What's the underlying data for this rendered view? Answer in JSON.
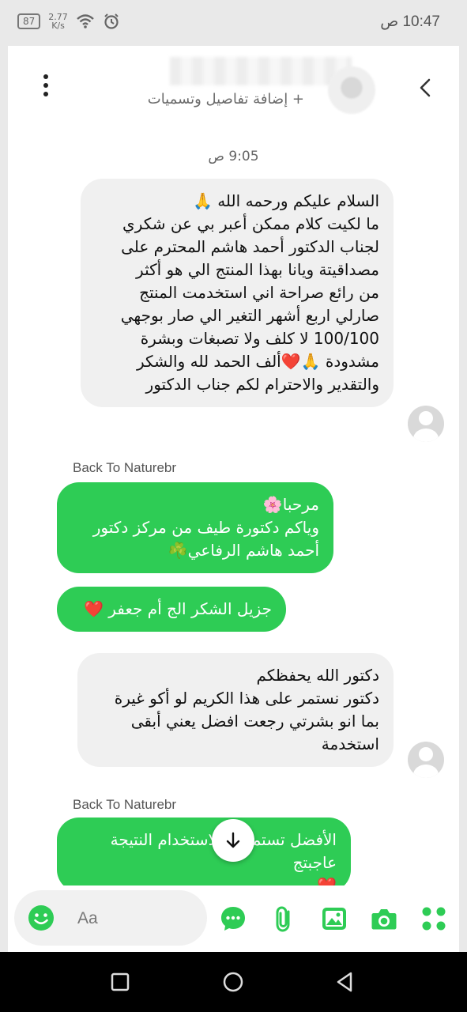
{
  "status_bar": {
    "battery": "87",
    "network_top": "2.77",
    "network_bottom": "K/s",
    "time": "10:47 ص"
  },
  "header": {
    "subtitle": "+ إضافة تفاصيل وتسميات"
  },
  "chat": {
    "timestamp": "9:05 ص",
    "messages": [
      {
        "direction": "incoming",
        "text": "السلام عليكم ورحمه الله 🙏\nما لكيت كلام ممكن أعبر بي عن  شكري\nلجناب الدكتور  أحمد هاشم المحترم على\nمصداقيتة ويانا بهذا المنتج الي هو أكثر\nمن رائع صراحة اني استخدمت المنتج\nصارلي اربع أشهر التغير الي صار بوجهي\n100/100  لا كلف ولا تصبغات وبشرة\nمشدودة 🙏❤️ألف الحمد لله والشكر\nوالتقدير والاحترام لكم جناب الدكتور"
      },
      {
        "direction": "outgoing",
        "sender": "Back To Naturebr",
        "text": "مرحبا🌸\nوياكم دكتورة طيف من مركز دكتور\nأحمد هاشم الرفاعي☘️"
      },
      {
        "direction": "outgoing",
        "text": "جزيل الشكر الج أم جعفر ❤️"
      },
      {
        "direction": "incoming",
        "text": "دكتور الله يحفظكم\nدكتور نستمر على هذا الكريم لو أكو غيرة\nبما انو بشرتي رجعت افضل يعني أبقى\nاستخدمة"
      },
      {
        "direction": "outgoing",
        "sender": "Back To Naturebr",
        "text": "الأفضل تستمري بالاستخدام النتيجة عاجبتج\n❤️"
      }
    ]
  },
  "composer": {
    "placeholder": "Aa"
  },
  "colors": {
    "accent": "#2ecc55",
    "incoming_bubble": "#f0f0f0"
  },
  "icons": [
    "emoji-icon",
    "chat-bubble-icon",
    "attachment-icon",
    "image-icon",
    "camera-icon",
    "apps-grid-icon",
    "scroll-down-icon",
    "back-chevron-icon",
    "more-options-icon"
  ]
}
